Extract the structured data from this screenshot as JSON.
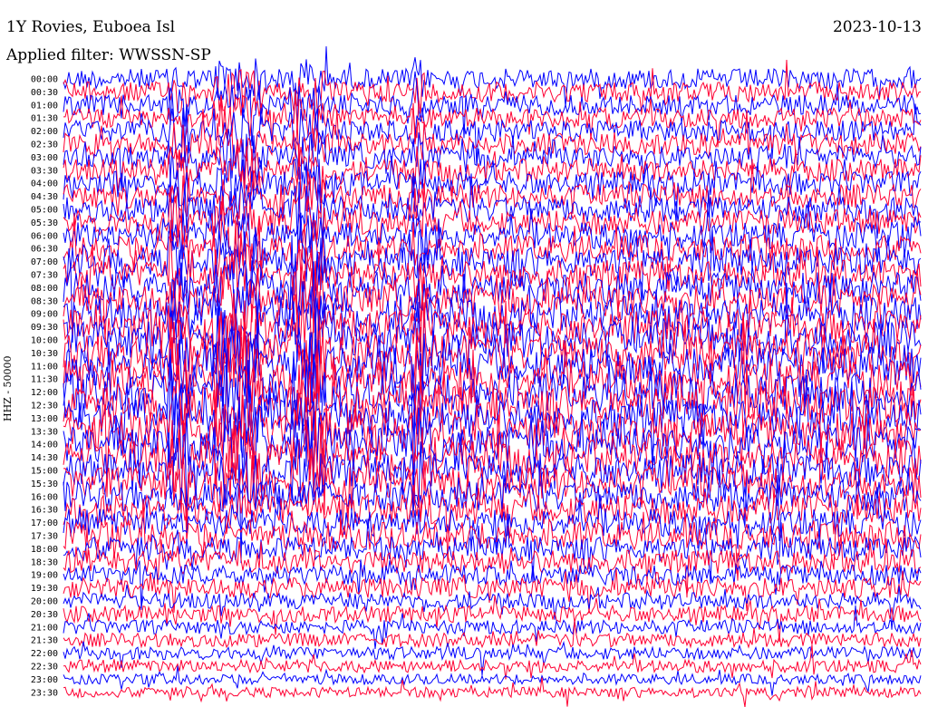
{
  "header": {
    "station": "1Y Rovies, Euboea Isl",
    "date": "2023-10-13",
    "filter": "Applied filter: WWSSN-SP"
  },
  "chart_data": {
    "type": "line",
    "title": "1Y Rovies, Euboea Isl",
    "ylabel": "HHZ - 50000",
    "row_labels": [
      "00:00",
      "00:30",
      "01:00",
      "01:30",
      "02:00",
      "02:30",
      "03:00",
      "03:30",
      "04:00",
      "04:30",
      "05:00",
      "05:30",
      "06:00",
      "06:30",
      "07:00",
      "07:30",
      "08:00",
      "08:30",
      "09:00",
      "09:30",
      "10:00",
      "10:30",
      "11:00",
      "11:30",
      "12:00",
      "12:30",
      "13:00",
      "13:30",
      "14:00",
      "14:30",
      "15:00",
      "15:30",
      "16:00",
      "16:30",
      "17:00",
      "17:30",
      "18:00",
      "18:30",
      "19:00",
      "19:30",
      "20:00",
      "20:30",
      "21:00",
      "21:30",
      "22:00",
      "22:30",
      "23:00",
      "23:30"
    ],
    "series": [
      {
        "color": "#0000ff"
      },
      {
        "color": "#ff0033"
      }
    ],
    "alternating_trace_colors": [
      "#0000ff",
      "#ff0033"
    ],
    "noise_amplitude_by_hour_relative": [
      1.6,
      1.6,
      1.7,
      1.8,
      1.9,
      2.0,
      2.1,
      2.3,
      2.5,
      2.7,
      2.9,
      3.0,
      3.0,
      3.0,
      2.8,
      2.6,
      2.4,
      2.2,
      1.9,
      1.6,
      1.3,
      1.1,
      1.0,
      0.8
    ],
    "grid": false
  }
}
